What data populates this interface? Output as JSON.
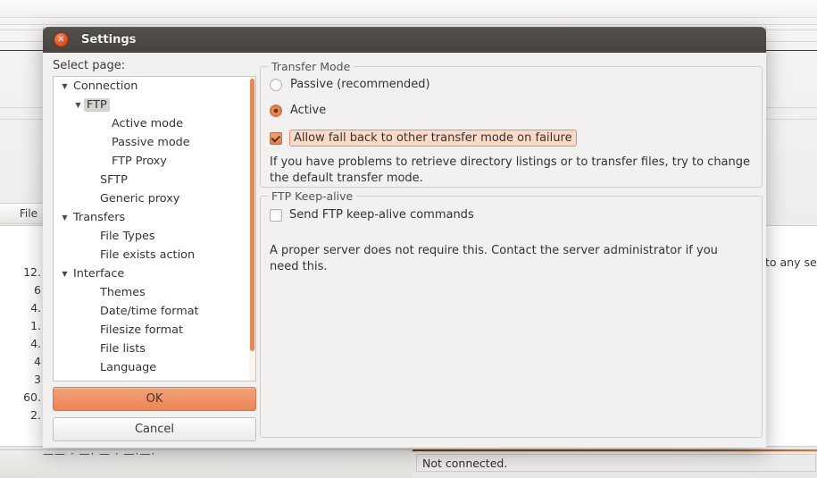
{
  "background_window": {
    "column_header_file": "File",
    "size_column_values": [
      "12.",
      "6",
      "4.",
      "1.",
      "4.",
      "4",
      "3",
      "60.",
      "2."
    ],
    "right_clipped_text": "to any se",
    "status_text": "Not connected."
  },
  "dialog": {
    "title": "Settings",
    "close_icon": "close-icon",
    "select_page_label": "Select page:",
    "tree": [
      {
        "label": "Connection",
        "level": 0,
        "twisty": "▼",
        "selected": false
      },
      {
        "label": "FTP",
        "level": 1,
        "twisty": "▼",
        "selected": true
      },
      {
        "label": "Active mode",
        "level": 2,
        "twisty": "",
        "selected": false
      },
      {
        "label": "Passive mode",
        "level": 2,
        "twisty": "",
        "selected": false
      },
      {
        "label": "FTP Proxy",
        "level": 2,
        "twisty": "",
        "selected": false
      },
      {
        "label": "SFTP",
        "level": 1,
        "twisty": "",
        "selected": false
      },
      {
        "label": "Generic proxy",
        "level": 1,
        "twisty": "",
        "selected": false
      },
      {
        "label": "Transfers",
        "level": 0,
        "twisty": "▼",
        "selected": false
      },
      {
        "label": "File Types",
        "level": 1,
        "twisty": "",
        "selected": false
      },
      {
        "label": "File exists action",
        "level": 1,
        "twisty": "",
        "selected": false
      },
      {
        "label": "Interface",
        "level": 0,
        "twisty": "▼",
        "selected": false
      },
      {
        "label": "Themes",
        "level": 1,
        "twisty": "",
        "selected": false
      },
      {
        "label": "Date/time format",
        "level": 1,
        "twisty": "",
        "selected": false
      },
      {
        "label": "Filesize format",
        "level": 1,
        "twisty": "",
        "selected": false
      },
      {
        "label": "File lists",
        "level": 1,
        "twisty": "",
        "selected": false
      },
      {
        "label": "Language",
        "level": 1,
        "twisty": "",
        "selected": false
      }
    ],
    "buttons": {
      "ok": "OK",
      "cancel": "Cancel"
    },
    "transfer_mode": {
      "group_title": "Transfer Mode",
      "passive_label": "Passive (recommended)",
      "passive_selected": false,
      "active_label": "Active",
      "active_selected": true,
      "fallback_label": "Allow fall back to other transfer mode on failure",
      "fallback_checked": true,
      "fallback_highlighted": true,
      "description": "If you have problems to retrieve directory listings or to transfer files, try to change the default transfer mode."
    },
    "ftp_keepalive": {
      "group_title": "FTP Keep-alive",
      "send_label": "Send FTP keep-alive commands",
      "send_checked": false,
      "description": "A proper server does not require this. Contact the server administrator if you need this."
    }
  },
  "colors": {
    "accent_orange": "#e4804f",
    "titlebar_dark": "#4b4844",
    "highlight_bg": "#f9d9c7",
    "highlight_border": "#dd9166"
  }
}
